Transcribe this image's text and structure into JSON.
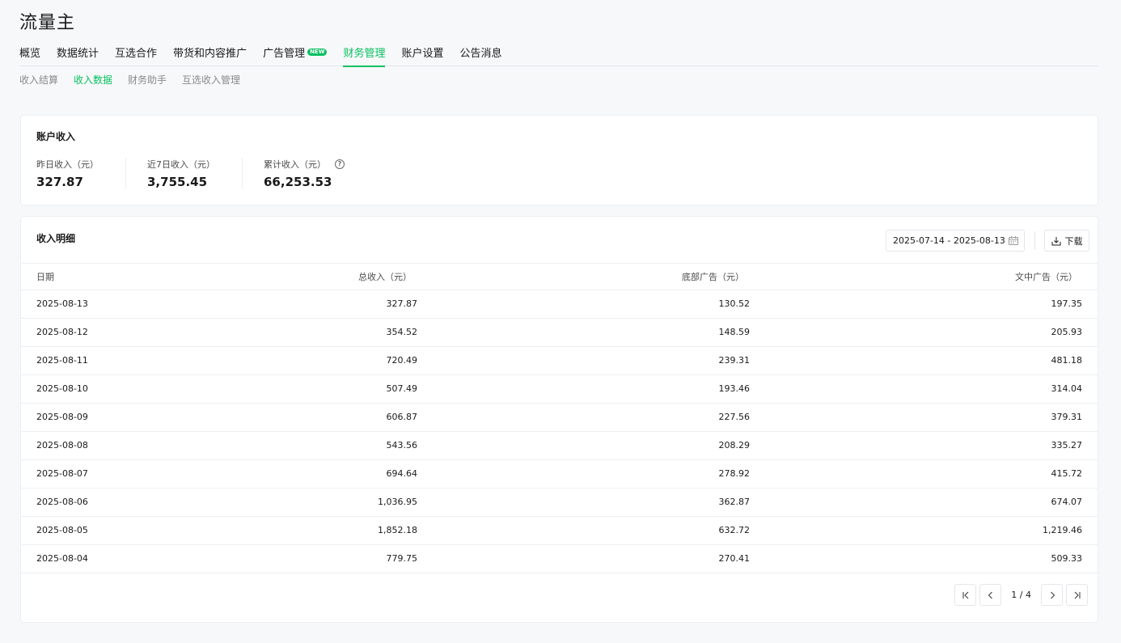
{
  "app": {
    "title": "流量主"
  },
  "main_nav": [
    {
      "label": "概览",
      "active": false
    },
    {
      "label": "数据统计",
      "active": false
    },
    {
      "label": "互选合作",
      "active": false
    },
    {
      "label": "带货和内容推广",
      "active": false
    },
    {
      "label": "广告管理",
      "active": false,
      "badge": "NEW"
    },
    {
      "label": "财务管理",
      "active": true
    },
    {
      "label": "账户设置",
      "active": false
    },
    {
      "label": "公告消息",
      "active": false
    }
  ],
  "sub_nav": [
    {
      "label": "收入结算",
      "active": false
    },
    {
      "label": "收入数据",
      "active": true
    },
    {
      "label": "财务助手",
      "active": false
    },
    {
      "label": "互选收入管理",
      "active": false
    }
  ],
  "account_income": {
    "title": "账户收入",
    "stats": [
      {
        "label": "昨日收入（元）",
        "value": "327.87"
      },
      {
        "label": "近7日收入（元）",
        "value": "3,755.45"
      },
      {
        "label": "累计收入（元）",
        "value": "66,253.53",
        "help_icon": "question-circle-icon"
      }
    ]
  },
  "income_detail": {
    "title": "收入明细",
    "date_range": "2025-07-14 - 2025-08-13",
    "download_label": "下载",
    "columns": [
      "日期",
      "总收入（元）",
      "底部广告（元）",
      "文中广告（元）"
    ],
    "rows": [
      [
        "2025-08-13",
        "327.87",
        "130.52",
        "197.35"
      ],
      [
        "2025-08-12",
        "354.52",
        "148.59",
        "205.93"
      ],
      [
        "2025-08-11",
        "720.49",
        "239.31",
        "481.18"
      ],
      [
        "2025-08-10",
        "507.49",
        "193.46",
        "314.04"
      ],
      [
        "2025-08-09",
        "606.87",
        "227.56",
        "379.31"
      ],
      [
        "2025-08-08",
        "543.56",
        "208.29",
        "335.27"
      ],
      [
        "2025-08-07",
        "694.64",
        "278.92",
        "415.72"
      ],
      [
        "2025-08-06",
        "1,036.95",
        "362.87",
        "674.07"
      ],
      [
        "2025-08-05",
        "1,852.18",
        "632.72",
        "1,219.46"
      ],
      [
        "2025-08-04",
        "779.75",
        "270.41",
        "509.33"
      ]
    ],
    "pagination": {
      "text": "1 / 4"
    }
  },
  "colors": {
    "accent": "#07c160",
    "border": "#e5e6eb",
    "background": "#f7f8fa"
  }
}
